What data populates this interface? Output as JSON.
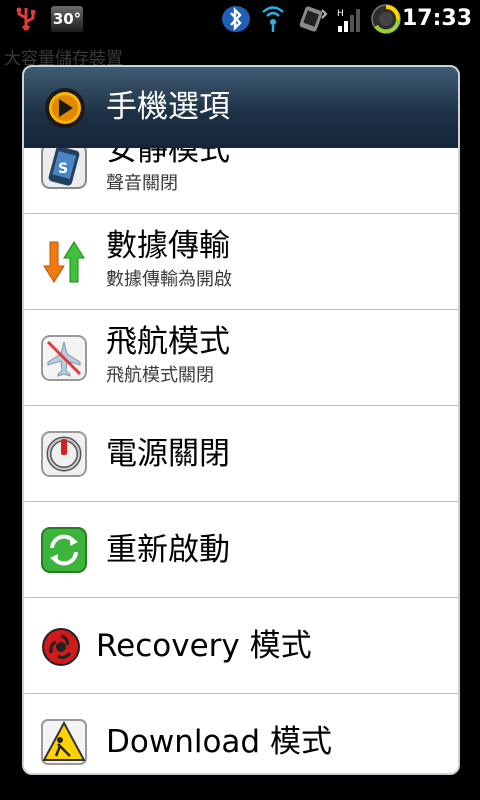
{
  "status_bar": {
    "temperature": "30°",
    "time": "17:33",
    "icons": [
      "usb-icon",
      "temperature-icon",
      "bluetooth-icon",
      "wifi-icon",
      "data-sync-icon",
      "signal-icon",
      "battery-icon"
    ]
  },
  "background": {
    "text": "大容量儲存裝置"
  },
  "dialog": {
    "title": "手機選項",
    "header_icon": "play-circle-icon",
    "items": [
      {
        "label": "安靜模式",
        "subtitle": "聲音關閉",
        "icon": "silent-mode-icon"
      },
      {
        "label": "數據傳輸",
        "subtitle": "數據傳輸為開啟",
        "icon": "data-transfer-icon"
      },
      {
        "label": "飛航模式",
        "subtitle": "飛航模式關閉",
        "icon": "airplane-mode-icon"
      },
      {
        "label": "電源關閉",
        "subtitle": "",
        "icon": "power-off-icon"
      },
      {
        "label": "重新啟動",
        "subtitle": "",
        "icon": "reboot-icon"
      },
      {
        "label": "Recovery 模式",
        "subtitle": "",
        "icon": "recovery-icon"
      },
      {
        "label": "Download 模式",
        "subtitle": "",
        "icon": "download-mode-icon"
      }
    ]
  },
  "colors": {
    "header_bg": "#1c3044",
    "divider": "#b9bec4",
    "list_bg": "#ffffff",
    "statusbar_bg": "#000000"
  }
}
